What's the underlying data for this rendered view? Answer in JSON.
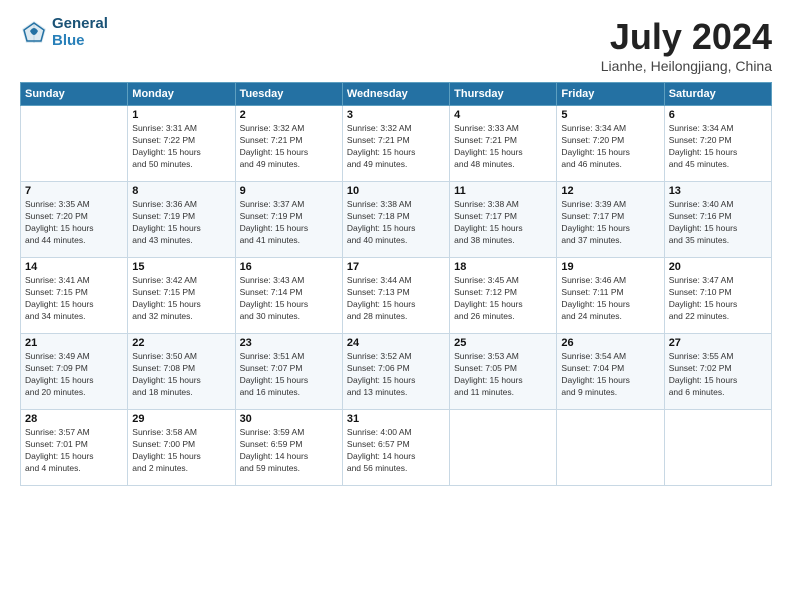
{
  "header": {
    "logo_line1": "General",
    "logo_line2": "Blue",
    "month": "July 2024",
    "location": "Lianhe, Heilongjiang, China"
  },
  "weekdays": [
    "Sunday",
    "Monday",
    "Tuesday",
    "Wednesday",
    "Thursday",
    "Friday",
    "Saturday"
  ],
  "weeks": [
    [
      {
        "day": "",
        "info": ""
      },
      {
        "day": "1",
        "info": "Sunrise: 3:31 AM\nSunset: 7:22 PM\nDaylight: 15 hours\nand 50 minutes."
      },
      {
        "day": "2",
        "info": "Sunrise: 3:32 AM\nSunset: 7:21 PM\nDaylight: 15 hours\nand 49 minutes."
      },
      {
        "day": "3",
        "info": "Sunrise: 3:32 AM\nSunset: 7:21 PM\nDaylight: 15 hours\nand 49 minutes."
      },
      {
        "day": "4",
        "info": "Sunrise: 3:33 AM\nSunset: 7:21 PM\nDaylight: 15 hours\nand 48 minutes."
      },
      {
        "day": "5",
        "info": "Sunrise: 3:34 AM\nSunset: 7:20 PM\nDaylight: 15 hours\nand 46 minutes."
      },
      {
        "day": "6",
        "info": "Sunrise: 3:34 AM\nSunset: 7:20 PM\nDaylight: 15 hours\nand 45 minutes."
      }
    ],
    [
      {
        "day": "7",
        "info": "Sunrise: 3:35 AM\nSunset: 7:20 PM\nDaylight: 15 hours\nand 44 minutes."
      },
      {
        "day": "8",
        "info": "Sunrise: 3:36 AM\nSunset: 7:19 PM\nDaylight: 15 hours\nand 43 minutes."
      },
      {
        "day": "9",
        "info": "Sunrise: 3:37 AM\nSunset: 7:19 PM\nDaylight: 15 hours\nand 41 minutes."
      },
      {
        "day": "10",
        "info": "Sunrise: 3:38 AM\nSunset: 7:18 PM\nDaylight: 15 hours\nand 40 minutes."
      },
      {
        "day": "11",
        "info": "Sunrise: 3:38 AM\nSunset: 7:17 PM\nDaylight: 15 hours\nand 38 minutes."
      },
      {
        "day": "12",
        "info": "Sunrise: 3:39 AM\nSunset: 7:17 PM\nDaylight: 15 hours\nand 37 minutes."
      },
      {
        "day": "13",
        "info": "Sunrise: 3:40 AM\nSunset: 7:16 PM\nDaylight: 15 hours\nand 35 minutes."
      }
    ],
    [
      {
        "day": "14",
        "info": "Sunrise: 3:41 AM\nSunset: 7:15 PM\nDaylight: 15 hours\nand 34 minutes."
      },
      {
        "day": "15",
        "info": "Sunrise: 3:42 AM\nSunset: 7:15 PM\nDaylight: 15 hours\nand 32 minutes."
      },
      {
        "day": "16",
        "info": "Sunrise: 3:43 AM\nSunset: 7:14 PM\nDaylight: 15 hours\nand 30 minutes."
      },
      {
        "day": "17",
        "info": "Sunrise: 3:44 AM\nSunset: 7:13 PM\nDaylight: 15 hours\nand 28 minutes."
      },
      {
        "day": "18",
        "info": "Sunrise: 3:45 AM\nSunset: 7:12 PM\nDaylight: 15 hours\nand 26 minutes."
      },
      {
        "day": "19",
        "info": "Sunrise: 3:46 AM\nSunset: 7:11 PM\nDaylight: 15 hours\nand 24 minutes."
      },
      {
        "day": "20",
        "info": "Sunrise: 3:47 AM\nSunset: 7:10 PM\nDaylight: 15 hours\nand 22 minutes."
      }
    ],
    [
      {
        "day": "21",
        "info": "Sunrise: 3:49 AM\nSunset: 7:09 PM\nDaylight: 15 hours\nand 20 minutes."
      },
      {
        "day": "22",
        "info": "Sunrise: 3:50 AM\nSunset: 7:08 PM\nDaylight: 15 hours\nand 18 minutes."
      },
      {
        "day": "23",
        "info": "Sunrise: 3:51 AM\nSunset: 7:07 PM\nDaylight: 15 hours\nand 16 minutes."
      },
      {
        "day": "24",
        "info": "Sunrise: 3:52 AM\nSunset: 7:06 PM\nDaylight: 15 hours\nand 13 minutes."
      },
      {
        "day": "25",
        "info": "Sunrise: 3:53 AM\nSunset: 7:05 PM\nDaylight: 15 hours\nand 11 minutes."
      },
      {
        "day": "26",
        "info": "Sunrise: 3:54 AM\nSunset: 7:04 PM\nDaylight: 15 hours\nand 9 minutes."
      },
      {
        "day": "27",
        "info": "Sunrise: 3:55 AM\nSunset: 7:02 PM\nDaylight: 15 hours\nand 6 minutes."
      }
    ],
    [
      {
        "day": "28",
        "info": "Sunrise: 3:57 AM\nSunset: 7:01 PM\nDaylight: 15 hours\nand 4 minutes."
      },
      {
        "day": "29",
        "info": "Sunrise: 3:58 AM\nSunset: 7:00 PM\nDaylight: 15 hours\nand 2 minutes."
      },
      {
        "day": "30",
        "info": "Sunrise: 3:59 AM\nSunset: 6:59 PM\nDaylight: 14 hours\nand 59 minutes."
      },
      {
        "day": "31",
        "info": "Sunrise: 4:00 AM\nSunset: 6:57 PM\nDaylight: 14 hours\nand 56 minutes."
      },
      {
        "day": "",
        "info": ""
      },
      {
        "day": "",
        "info": ""
      },
      {
        "day": "",
        "info": ""
      }
    ]
  ]
}
